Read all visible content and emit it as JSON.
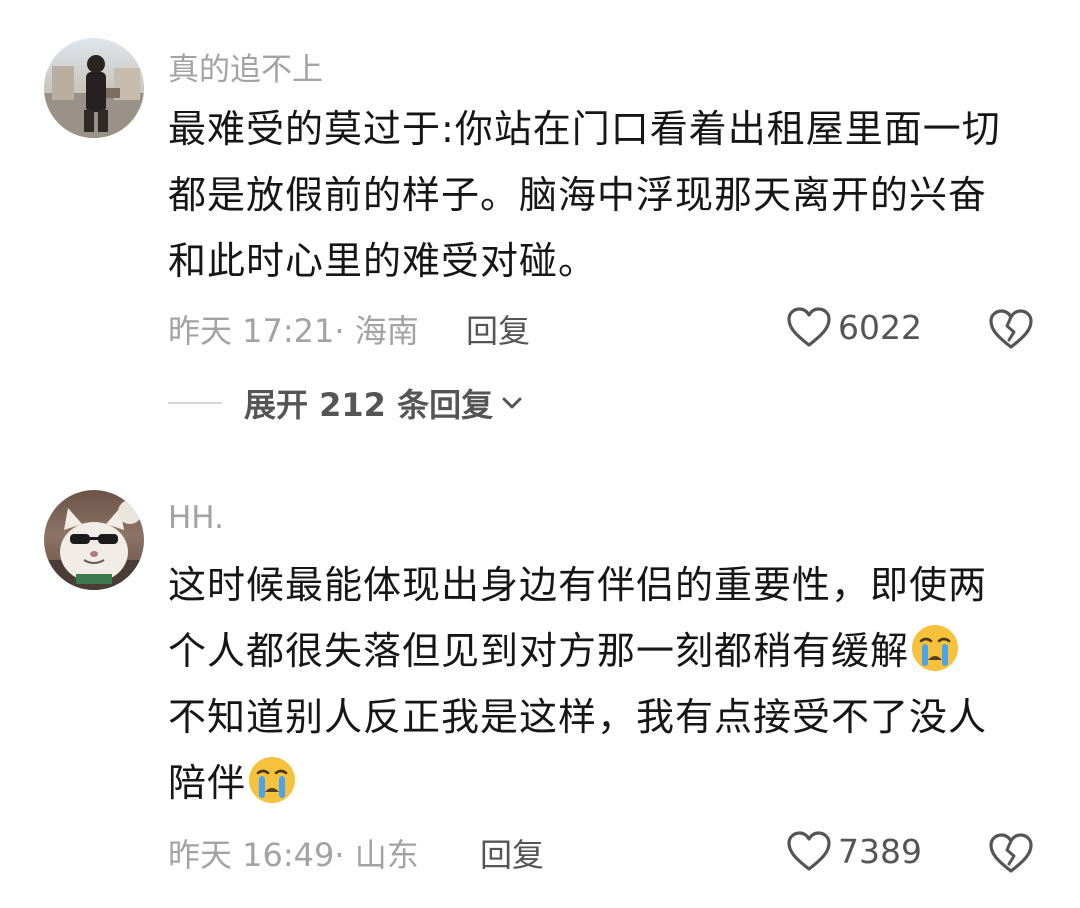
{
  "comments": [
    {
      "username": "真的追不上",
      "lines": [
        "最难受的莫过于:你站在门口看着出租屋里面一切",
        "都是放假前的样子。脑海中浮现那天离开的兴奋",
        "和此时心里的难受对碰。"
      ],
      "time_location": "昨天 17:21· 海南",
      "reply_label": "回复",
      "like_count": "6022",
      "expand_label": "展开 212 条回复"
    },
    {
      "username": "HH.",
      "lines": [
        "这时候最能体现出身边有伴侣的重要性，即使两",
        "个人都很失落但见到对方那一刻都稍有缓解",
        "不知道别人反正我是这样，我有点接受不了没人",
        "陪伴"
      ],
      "emoji": "crying-face",
      "time_location": "昨天 16:49· 山东",
      "reply_label": "回复",
      "like_count": "7389"
    }
  ],
  "icons": {
    "like": "heart-outline-icon",
    "dislike": "broken-heart-icon",
    "expand": "chevron-down-icon"
  },
  "colors": {
    "text": "#161616",
    "secondary": "#a3a3a3",
    "action": "#555555"
  }
}
